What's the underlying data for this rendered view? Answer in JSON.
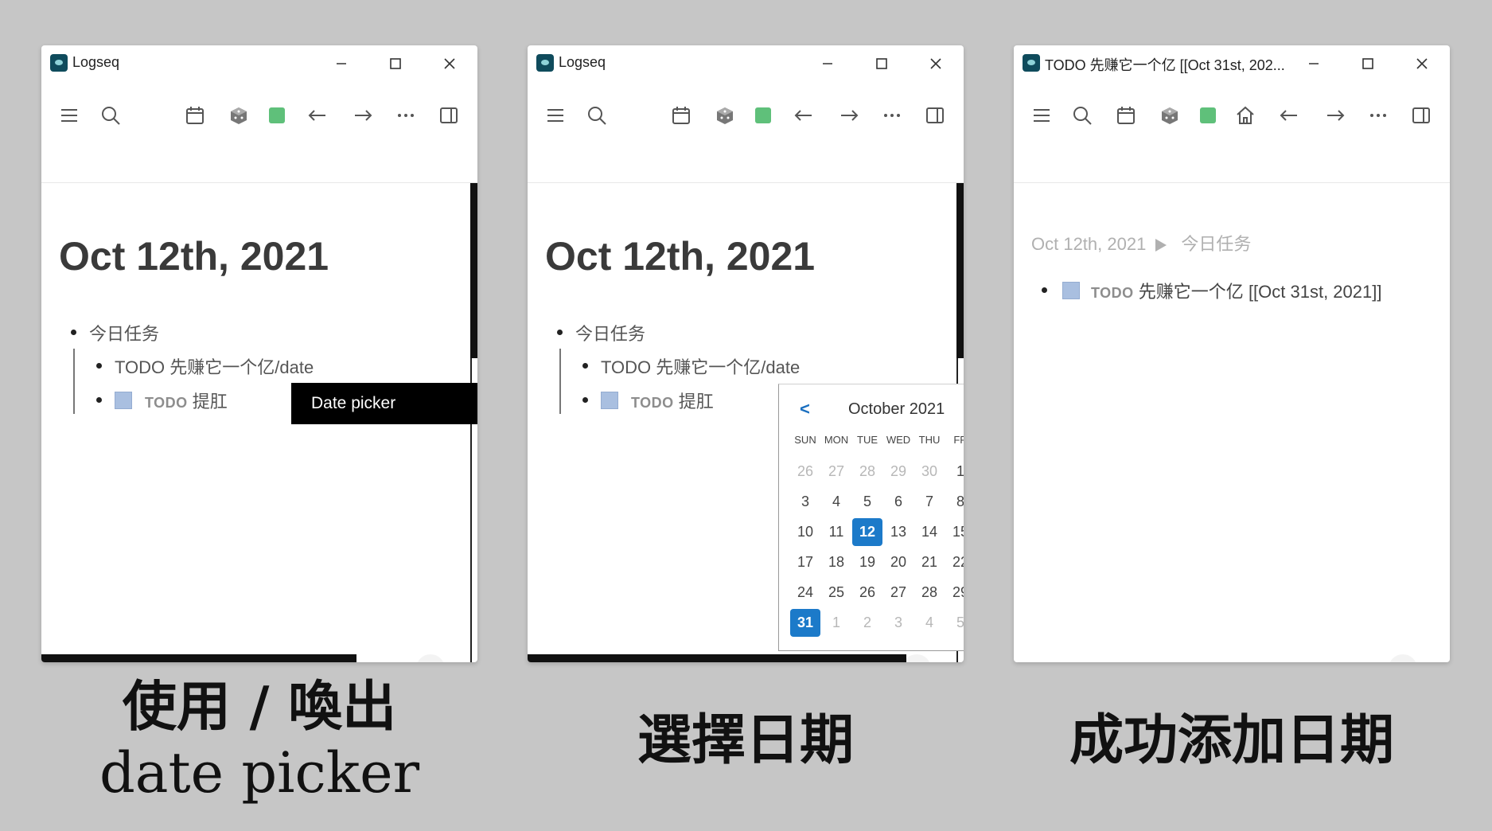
{
  "windows": [
    {
      "title": "Logseq",
      "page_title": "Oct 12th, 2021",
      "blocks": {
        "parent": "今日任务",
        "child1": "TODO 先赚它一个亿/date",
        "child2_marker": "TODO",
        "child2_text": "提肛"
      },
      "tooltip": "Date picker",
      "help": "?"
    },
    {
      "title": "Logseq",
      "page_title": "Oct 12th, 2021",
      "blocks": {
        "parent": "今日任务",
        "child1": "TODO 先赚它一个亿/date",
        "child2_marker": "TODO",
        "child2_text": "提肛"
      },
      "help": "?"
    },
    {
      "title": "TODO 先赚它一个亿 [[Oct 31st, 202...",
      "breadcrumb": {
        "parent": "Oct 12th, 2021",
        "current": "今日任务"
      },
      "block": {
        "marker": "TODO",
        "text": "先赚它一个亿",
        "link": "[[Oct 31st, 2021]]"
      },
      "help": "?"
    }
  ],
  "date_picker": {
    "prev": "<",
    "month": "October 2021",
    "weekdays": [
      "SUN",
      "MON",
      "TUE",
      "WED",
      "THU",
      "FR"
    ],
    "weeks": [
      [
        "26",
        "27",
        "28",
        "29",
        "30",
        "1"
      ],
      [
        "3",
        "4",
        "5",
        "6",
        "7",
        "8"
      ],
      [
        "10",
        "11",
        "12",
        "13",
        "14",
        "15"
      ],
      [
        "17",
        "18",
        "19",
        "20",
        "21",
        "22"
      ],
      [
        "24",
        "25",
        "26",
        "27",
        "28",
        "29"
      ],
      [
        "31",
        "1",
        "2",
        "3",
        "4",
        "5"
      ]
    ],
    "today": "12",
    "selected": "31"
  },
  "captions": {
    "step1_line1": "使用 / 喚出",
    "step1_line2": "date picker",
    "step2": "選擇日期",
    "step3": "成功添加日期"
  },
  "icons": {
    "toolbar": [
      "menu-icon",
      "search-icon",
      "calendar-icon",
      "cube-icon",
      "green-square-icon",
      "back-arrow-icon",
      "forward-arrow-icon",
      "more-icon",
      "sidebar-icon"
    ],
    "window3_extra": "home-icon",
    "window_controls": [
      "minimize-icon",
      "maximize-icon",
      "close-icon"
    ]
  },
  "colors": {
    "background": "#c6c6c6",
    "selected_date": "#1c7ac9",
    "checkbox": "#a9bfe0",
    "green_square": "#5fc07a"
  }
}
